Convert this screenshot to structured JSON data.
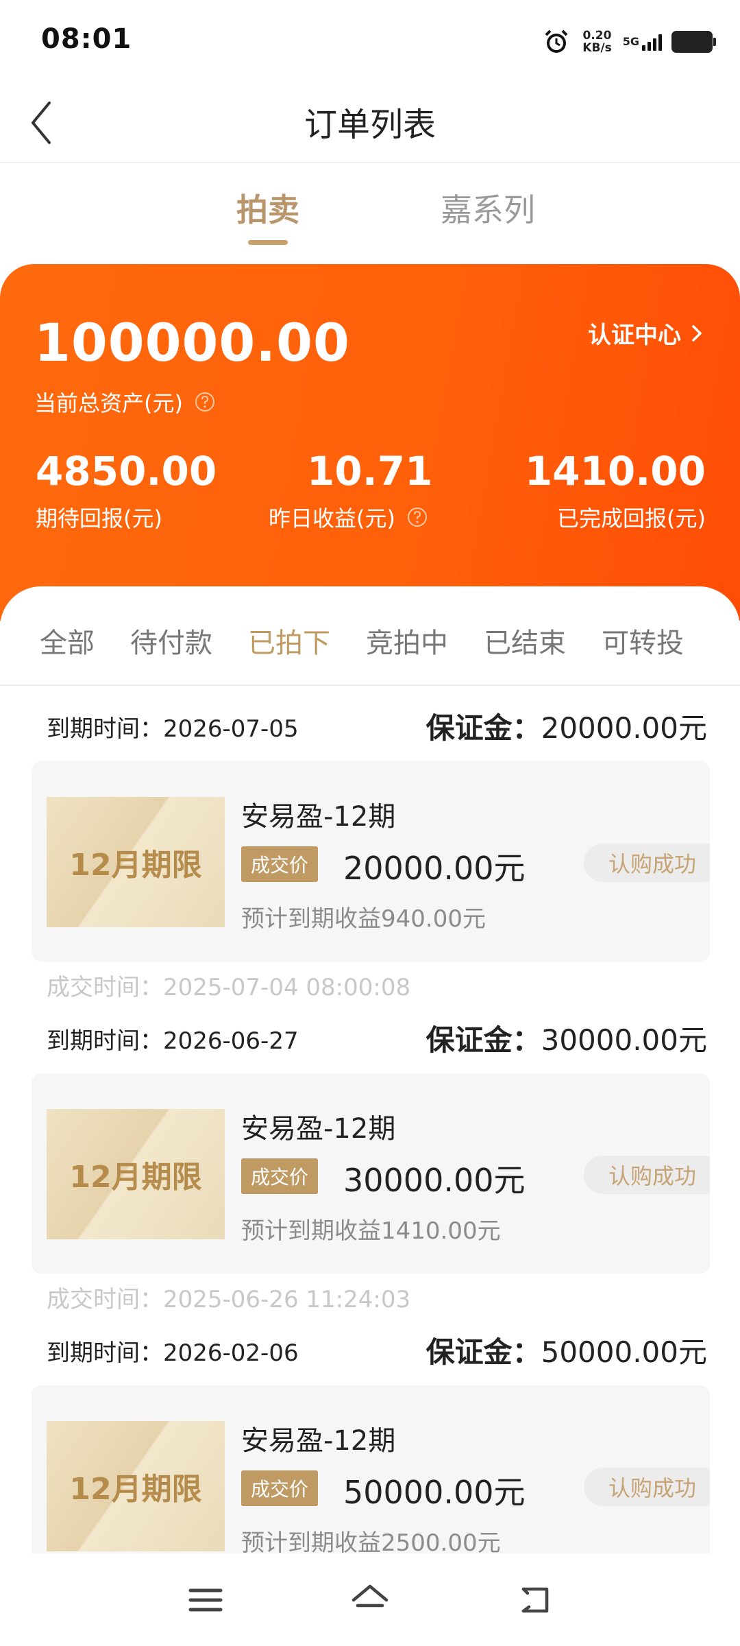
{
  "status_bar": {
    "time": "08:01",
    "net_speed_value": "0.20",
    "net_speed_unit": "KB/s",
    "network": "5G"
  },
  "header": {
    "title": "订单列表"
  },
  "top_tabs": [
    {
      "label": "拍卖",
      "active": true
    },
    {
      "label": "嘉系列",
      "active": false
    }
  ],
  "assets": {
    "total": "100000.00",
    "total_label": "当前总资产(元)",
    "cert_center": "认证中心",
    "stats": [
      {
        "value": "4850.00",
        "label": "期待回报(元)"
      },
      {
        "value": "10.71",
        "label": "昨日收益(元)"
      },
      {
        "value": "1410.00",
        "label": "已完成回报(元)"
      }
    ]
  },
  "filter_tabs": [
    {
      "label": "全部",
      "active": false
    },
    {
      "label": "待付款",
      "active": false
    },
    {
      "label": "已拍下",
      "active": true
    },
    {
      "label": "竞拍中",
      "active": false
    },
    {
      "label": "已结束",
      "active": false
    },
    {
      "label": "可转投",
      "active": false
    }
  ],
  "orders": [
    {
      "expiry": "到期时间：2026-07-05",
      "deposit_label": "保证金：",
      "deposit_value": "20000.00元",
      "term": "12月期限",
      "product": "安易盈-12期",
      "price_tag": "成交价",
      "price": "20000.00元",
      "expected": "预计到期收益940.00元",
      "status": "认购成功",
      "deal_time": "成交时间：2025-07-04 08:00:08"
    },
    {
      "expiry": "到期时间：2026-06-27",
      "deposit_label": "保证金：",
      "deposit_value": "30000.00元",
      "term": "12月期限",
      "product": "安易盈-12期",
      "price_tag": "成交价",
      "price": "30000.00元",
      "expected": "预计到期收益1410.00元",
      "status": "认购成功",
      "deal_time": "成交时间：2025-06-26 11:24:03"
    },
    {
      "expiry": "到期时间：2026-02-06",
      "deposit_label": "保证金：",
      "deposit_value": "50000.00元",
      "term": "12月期限",
      "product": "安易盈-12期",
      "price_tag": "成交价",
      "price": "50000.00元",
      "expected": "预计到期收益2500.00元",
      "status": "认购成功",
      "deal_time": ""
    }
  ],
  "colors": {
    "accent_gold": "#c19a62",
    "banner_orange": "#ff5f0a",
    "price_tag_bg": "#bf9a63"
  },
  "icons": {
    "alarm": "alarm-clock-icon",
    "back": "chevron-left-icon",
    "help": "question-circle-icon",
    "cert_chevron": "chevron-right-icon",
    "nav_menu": "menu-icon",
    "nav_home": "home-icon",
    "nav_back": "back-arrow-icon"
  }
}
